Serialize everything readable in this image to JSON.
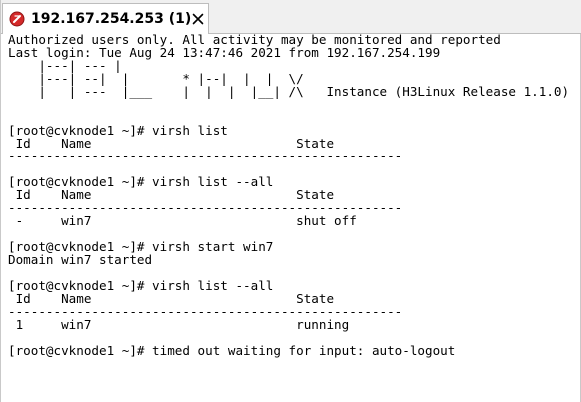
{
  "tab": {
    "title": "192.167.254.253 (1)",
    "icon": "terminal-session-icon",
    "close_icon": "close-icon"
  },
  "terminal": {
    "lines": [
      "Authorized users only. All activity may be monitored and reported",
      "Last login: Tue Aug 24 13:47:46 2021 from 192.167.254.199",
      "    |---| --- |",
      "    |---| --|  |       * |--|  |  |  \\/",
      "    |   | ---  |___    |  |  |  |__| /\\   Instance (H3Linux Release 1.1.0)",
      "",
      "",
      "[root@cvknode1 ~]# virsh list",
      " Id    Name                           State",
      "----------------------------------------------------",
      "",
      "[root@cvknode1 ~]# virsh list --all",
      " Id    Name                           State",
      "----------------------------------------------------",
      " -     win7                           shut off",
      "",
      "[root@cvknode1 ~]# virsh start win7",
      "Domain win7 started",
      "",
      "[root@cvknode1 ~]# virsh list --all",
      " Id    Name                           State",
      "----------------------------------------------------",
      " 1     win7                           running",
      "",
      "[root@cvknode1 ~]# timed out waiting for input: auto-logout"
    ]
  },
  "colors": {
    "tab_bar_bg": "#f0f0f0",
    "icon_red": "#d42a2a",
    "text": "#000000"
  }
}
